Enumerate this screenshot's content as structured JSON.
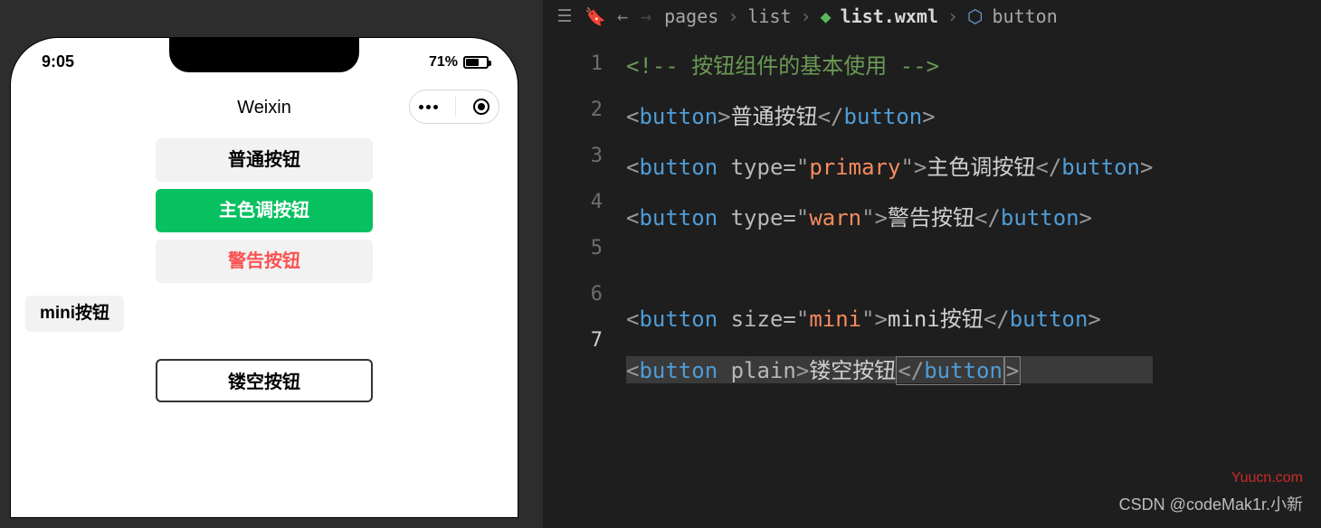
{
  "phone": {
    "statusbar": {
      "time": "9:05",
      "battery_pct": "71%"
    },
    "navbar": {
      "title": "Weixin"
    },
    "buttons": {
      "default": "普通按钮",
      "primary": "主色调按钮",
      "warn": "警告按钮",
      "mini": "mini按钮",
      "plain": "镂空按钮"
    }
  },
  "editor": {
    "breadcrumbs": {
      "seg1": "pages",
      "seg2": "list",
      "file": "list.wxml",
      "symbol": "button"
    },
    "gutter": [
      "1",
      "2",
      "3",
      "4",
      "5",
      "6",
      "7"
    ],
    "code": {
      "l1_comment": "<!-- 按钮组件的基本使用 -->",
      "l2": {
        "open": "<",
        "tag": "button",
        "gt": ">",
        "text": "普通按钮",
        "close_open": "</",
        "close_tag": "button",
        "close_gt": ">"
      },
      "l3": {
        "open": "<",
        "tag": "button",
        "sp": " ",
        "attr": "type=",
        "q": "\"",
        "val": "primary",
        "gt": ">",
        "text": "主色调按钮",
        "close_open": "</",
        "close_tag": "button",
        "close_gt": ">"
      },
      "l4": {
        "open": "<",
        "tag": "button",
        "sp": " ",
        "attr": "type=",
        "q": "\"",
        "val": "warn",
        "gt": ">",
        "text": "警告按钮",
        "close_open": "</",
        "close_tag": "button",
        "close_gt": ">"
      },
      "l6": {
        "open": "<",
        "tag": "button",
        "sp": " ",
        "attr": "size=",
        "q": "\"",
        "val": "mini",
        "gt": ">",
        "text": "mini按钮",
        "close_open": "</",
        "close_tag": "button",
        "close_gt": ">"
      },
      "l7": {
        "open": "<",
        "tag": "button",
        "sp": " ",
        "attr": "plain",
        "gt": ">",
        "text": "镂空按钮",
        "close_open": "</",
        "close_tag": "button",
        "close_gt": ">"
      }
    }
  },
  "watermarks": {
    "w1": "Yuucn.com",
    "w2": "CSDN @codeMak1r.小新"
  }
}
